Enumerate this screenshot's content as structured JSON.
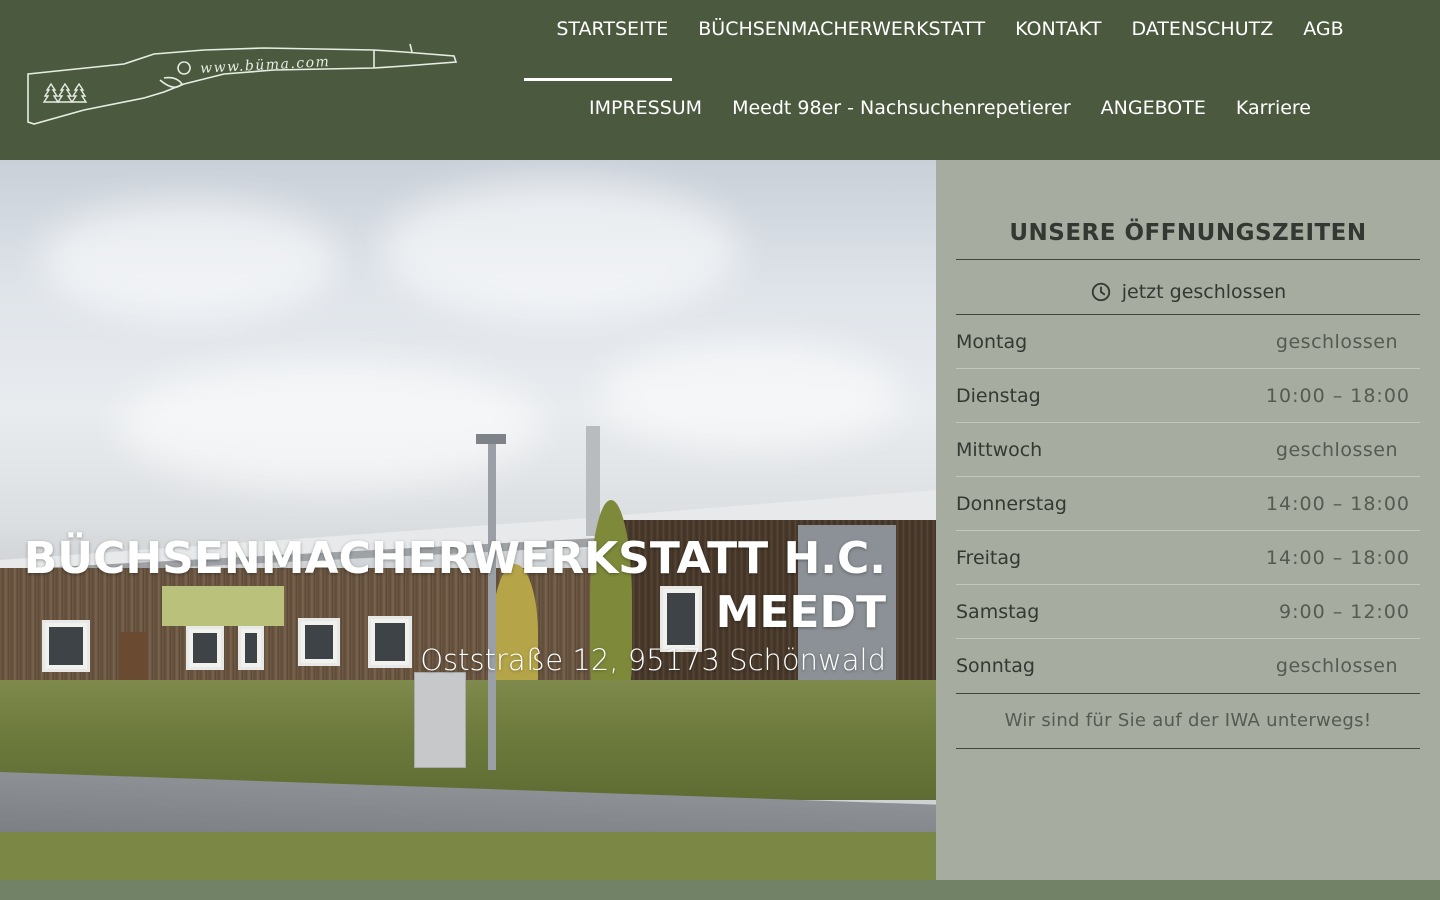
{
  "header": {
    "logo_text": "www.büma.com",
    "nav_row1": [
      "STARTSEITE",
      "BÜCHSENMACHERWERKSTATT",
      "KONTAKT",
      "DATENSCHUTZ",
      "AGB"
    ],
    "nav_row2": [
      "IMPRESSUM",
      "Meedt 98er - Nachsuchenrepetierer",
      "ANGEBOTE",
      "Karriere"
    ],
    "active_item": "STARTSEITE"
  },
  "hero": {
    "title": "BÜCHSENMACHERWERKSTATT H.C. MEEDT",
    "address": "Oststraße 12, 95173 Schönwald"
  },
  "hours": {
    "title": "UNSERE ÖFFNUNGSZEITEN",
    "status": "jetzt geschlossen",
    "status_icon": "clock-icon",
    "days": [
      {
        "day": "Montag",
        "time": "geschlossen"
      },
      {
        "day": "Dienstag",
        "time": "10:00  –  18:00"
      },
      {
        "day": "Mittwoch",
        "time": "geschlossen"
      },
      {
        "day": "Donnerstag",
        "time": "14:00  –  18:00"
      },
      {
        "day": "Freitag",
        "time": "14:00  –  18:00"
      },
      {
        "day": "Samstag",
        "time": "9:00  –  12:00"
      },
      {
        "day": "Sonntag",
        "time": "geschlossen"
      }
    ],
    "note": "Wir sind für Sie auf der IWA unterwegs!"
  },
  "colors": {
    "header_bg": "#4b5a3f",
    "panel_bg": "#a7aca0",
    "text_dark": "#333833"
  }
}
